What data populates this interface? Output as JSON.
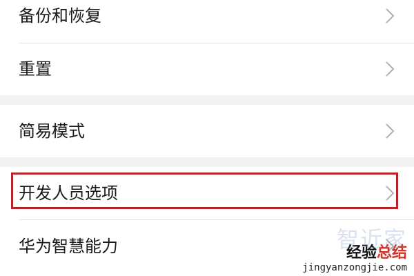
{
  "settings": {
    "items": [
      {
        "label": "备份和恢复",
        "icon": "chevron-right-icon"
      },
      {
        "label": "重置",
        "icon": "chevron-right-icon"
      },
      {
        "label": "简易模式",
        "icon": "chevron-right-icon"
      },
      {
        "label": "开发人员选项",
        "icon": "chevron-right-icon"
      },
      {
        "label": "华为智慧能力",
        "icon": "chevron-right-icon"
      }
    ],
    "highlight_color": "#b8232a"
  },
  "watermark": {
    "top_text": "智近家",
    "main_prefix": "经验",
    "main_accent": "总结",
    "url": "jingyanzongjie.com"
  }
}
